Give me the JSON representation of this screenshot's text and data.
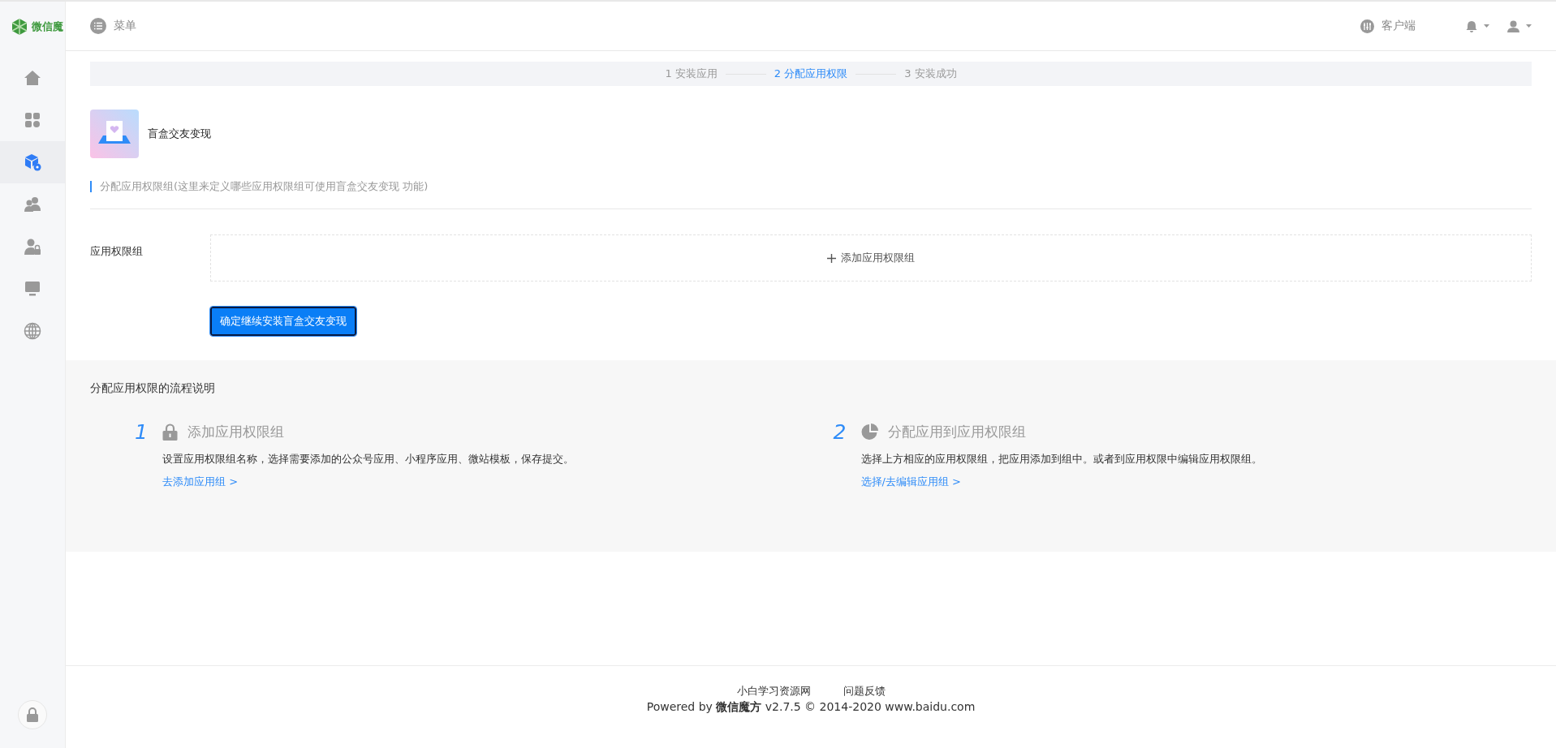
{
  "sidebar": {
    "logo": "微信魔",
    "items": [
      {
        "kind": "home",
        "selected": false
      },
      {
        "kind": "apps",
        "selected": false
      },
      {
        "kind": "cube",
        "selected": true
      },
      {
        "kind": "users",
        "selected": false
      },
      {
        "kind": "userlock",
        "selected": false
      },
      {
        "kind": "monitor",
        "selected": false
      },
      {
        "kind": "globe",
        "selected": false
      }
    ]
  },
  "header": {
    "menu": "菜单",
    "client": "客户端"
  },
  "steps": [
    {
      "label": "1 安装应用",
      "selected": false
    },
    {
      "label": "2 分配应用权限",
      "selected": true
    },
    {
      "label": "3 安装成功",
      "selected": false
    }
  ],
  "app": {
    "name": "盲盒交友变现"
  },
  "hint": "分配应用权限组(这里来定义哪些应用权限组可使用盲盒交友变现 功能)",
  "form": {
    "label": "应用权限组",
    "add": "添加应用权限组",
    "confirm": "确定继续安装盲盒交友变现"
  },
  "guide": {
    "title": "分配应用权限的流程说明",
    "steps": [
      {
        "kind": "lock",
        "number": "1",
        "title": "添加应用权限组",
        "text": "设置应用权限组名称，选择需要添加的公众号应用、小程序应用、微站模板，保存提交。",
        "link": "去添加应用组 >"
      },
      {
        "kind": "pie",
        "number": "2",
        "title": "分配应用到应用权限组",
        "text": "选择上方相应的应用权限组，把应用添加到组中。或者到应用权限中编辑应用权限组。",
        "link": "选择/去编辑应用组 >"
      }
    ]
  },
  "footer": {
    "links": [
      "小白学习资源网",
      "问题反馈"
    ],
    "powered": "Powered by **微信魔方** v2.7.5 © 2014-2020 www.baidu.com"
  }
}
